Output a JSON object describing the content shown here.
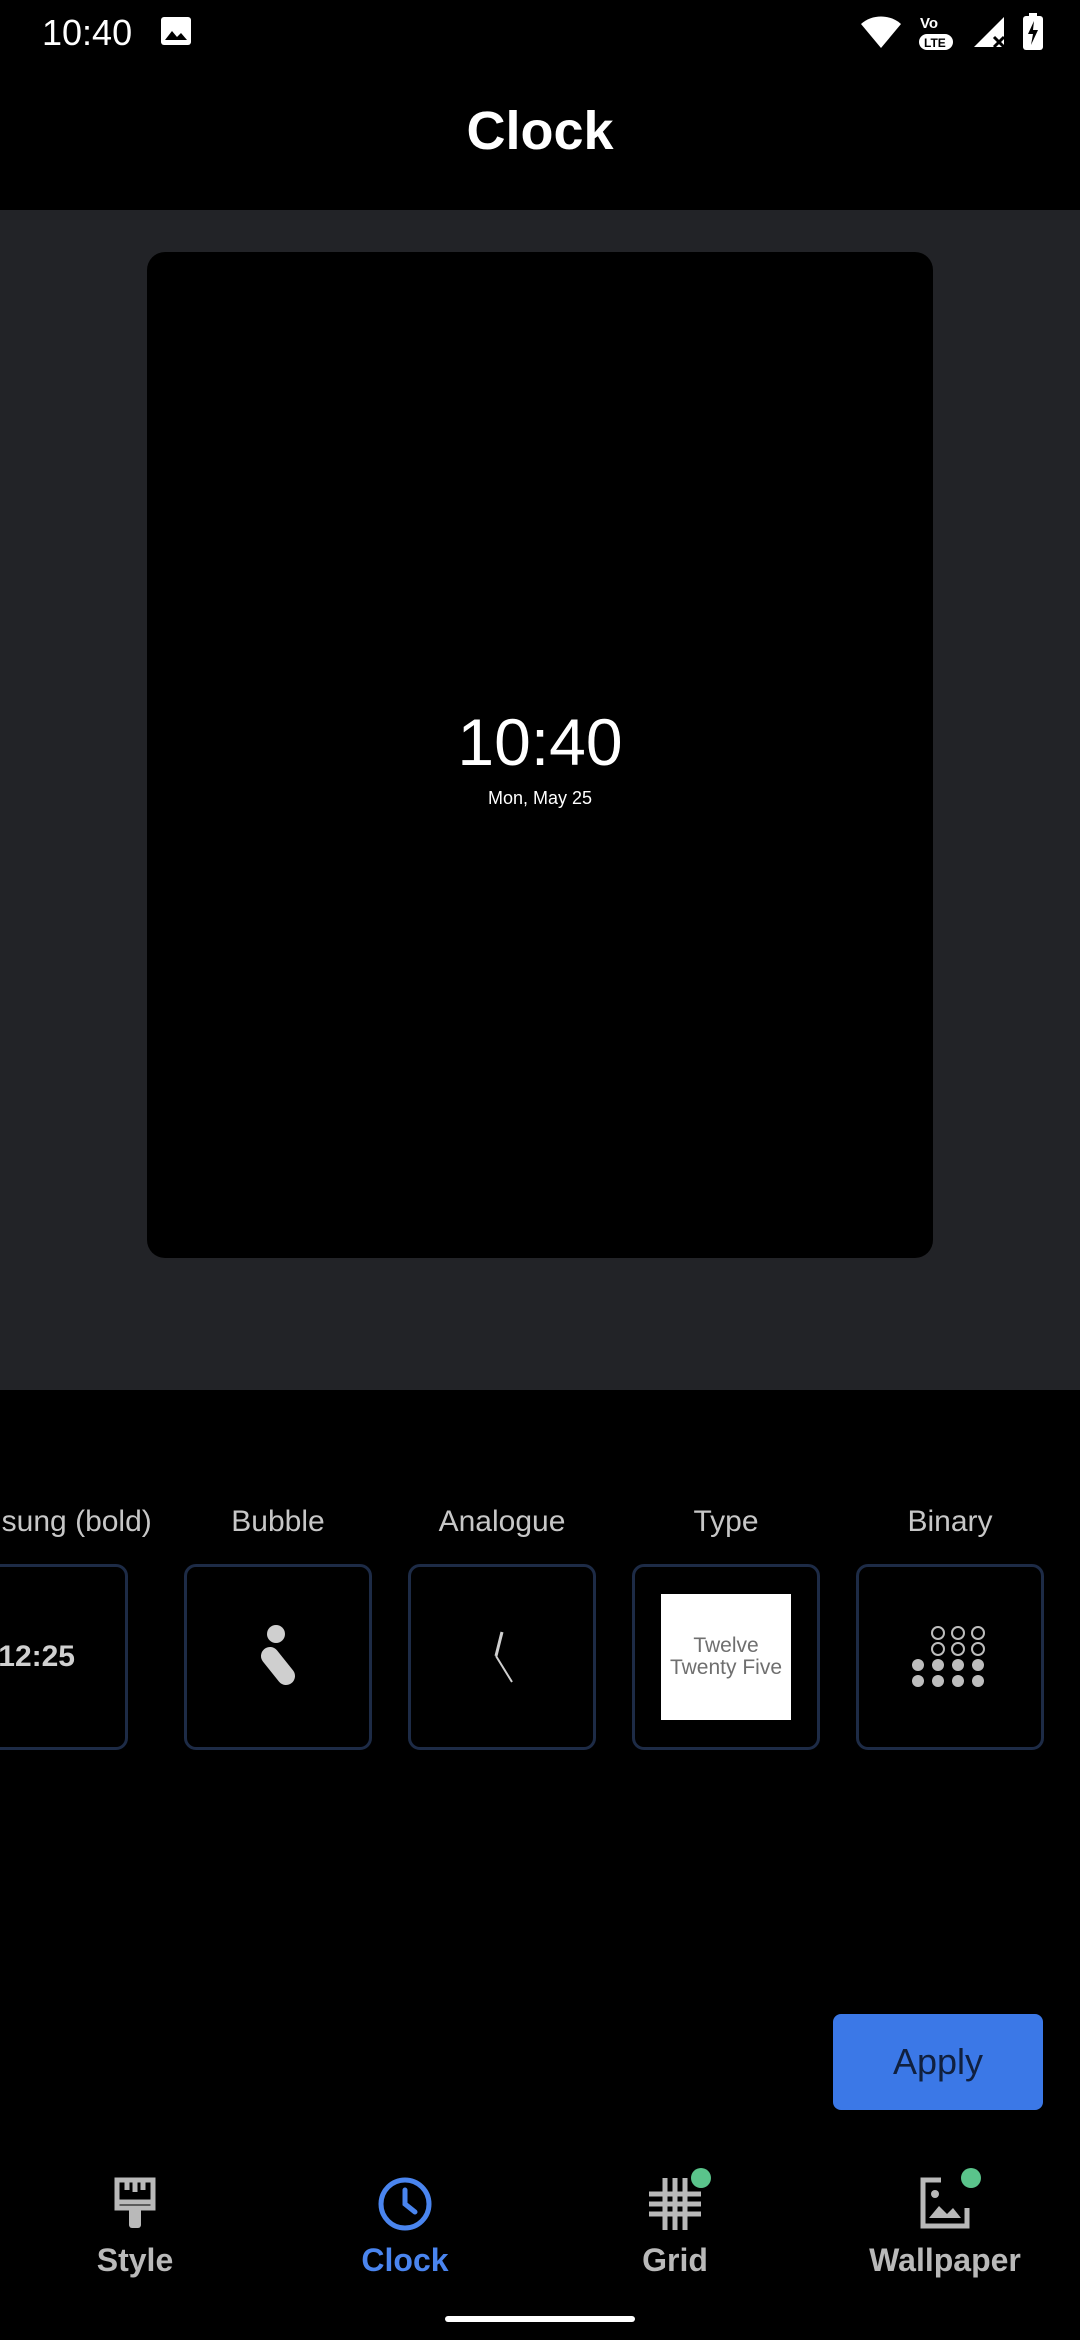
{
  "status_bar": {
    "time": "10:40",
    "icons": [
      "image-icon",
      "wifi-icon",
      "volte-lte-icon",
      "signal-icon",
      "battery-charging-icon"
    ]
  },
  "header": {
    "title": "Clock"
  },
  "preview": {
    "time": "10:40",
    "date": "Mon, May 25"
  },
  "clock_options": [
    {
      "label": "Samsung (bold)",
      "preview_text": "12:25",
      "icon": "digital-bold-preview"
    },
    {
      "label": "Bubble",
      "icon": "bubble-preview"
    },
    {
      "label": "Analogue",
      "icon": "analogue-hands-preview"
    },
    {
      "label": "Type",
      "line1": "Twelve",
      "line2": "Twenty Five",
      "icon": "type-preview"
    },
    {
      "label": "Binary",
      "icon": "binary-dots-preview"
    }
  ],
  "apply_button": {
    "label": "Apply",
    "color": "#3b78e7"
  },
  "bottom_nav": {
    "items": [
      {
        "label": "Style",
        "icon": "paintbrush-icon",
        "active": false
      },
      {
        "label": "Clock",
        "icon": "clock-icon",
        "active": true
      },
      {
        "label": "Grid",
        "icon": "grid-icon",
        "active": false,
        "badge": true
      },
      {
        "label": "Wallpaper",
        "icon": "wallpaper-icon",
        "active": false,
        "badge": true
      }
    ],
    "active_color": "#4a85ef",
    "badge_color": "#5ac48b"
  }
}
